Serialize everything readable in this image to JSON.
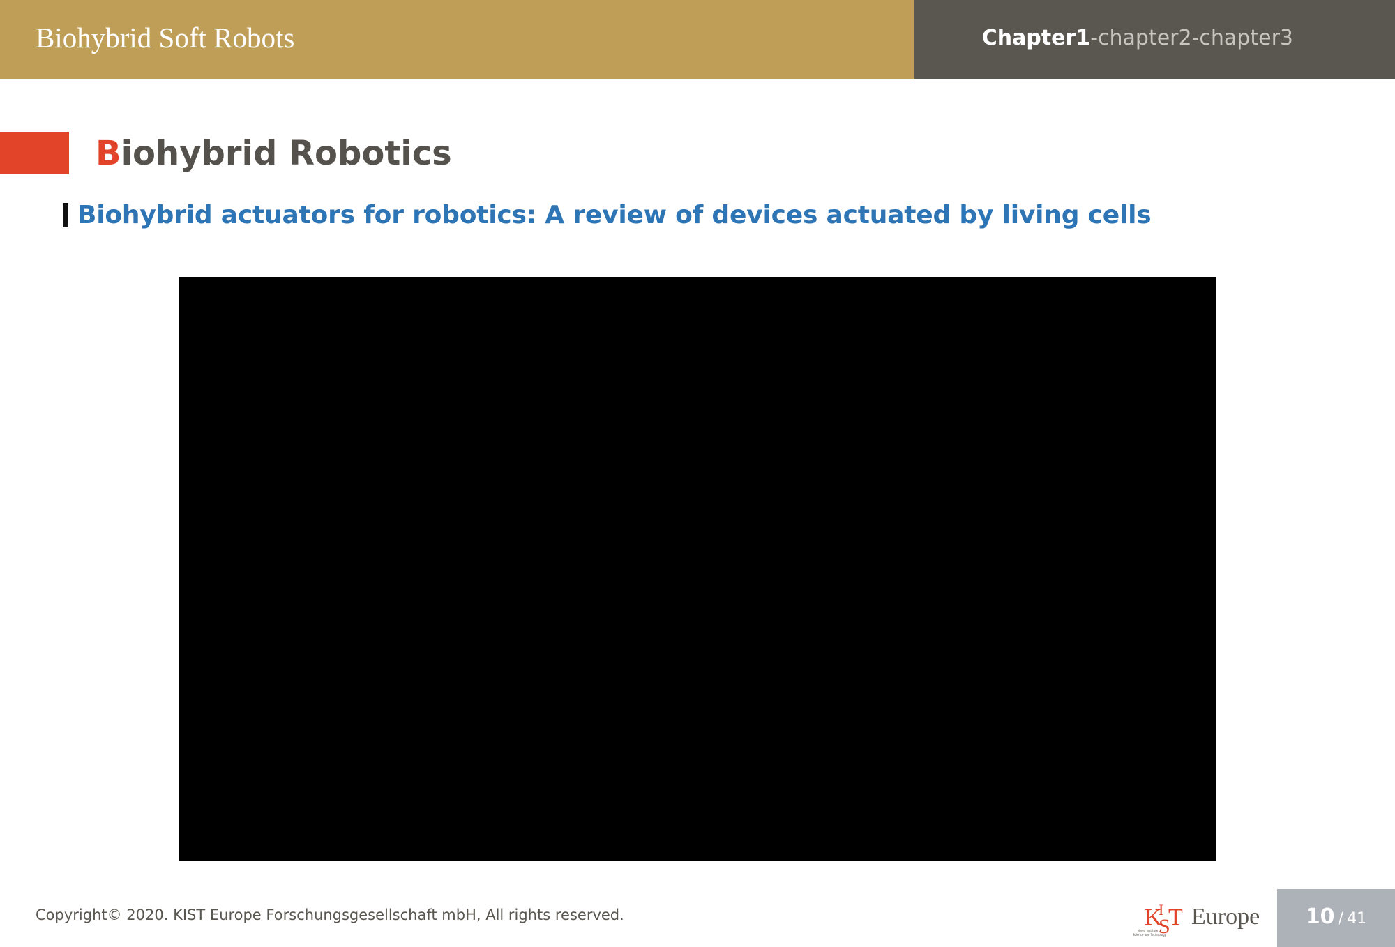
{
  "header": {
    "title": "Biohybrid Soft Robots",
    "chapter_current": "Chapter1",
    "chapter_rest": "-chapter2-chapter3"
  },
  "section": {
    "title_first_letter": "B",
    "title_rest": "iohybrid Robotics"
  },
  "subtitle": "Biohybrid actuators for robotics: A review of devices actuated by living cells",
  "footer": {
    "copyright": "Copyright© 2020. KIST Europe Forschungsgesellschaft mbH, All rights reserved.",
    "logo_text": "Europe",
    "logo_mark": "KIST",
    "logo_caption": "Korea Institute of Science and Technology"
  },
  "pagination": {
    "current": "10",
    "separator": "/",
    "total": "41"
  },
  "colors": {
    "header_gold": "#bf9f58",
    "header_dark": "#5a5650",
    "accent_red": "#e2442a",
    "subtitle_blue": "#2e75b6",
    "page_box_gray": "#adb2b8"
  },
  "icons": {
    "logo": "kist-europe-logo"
  }
}
